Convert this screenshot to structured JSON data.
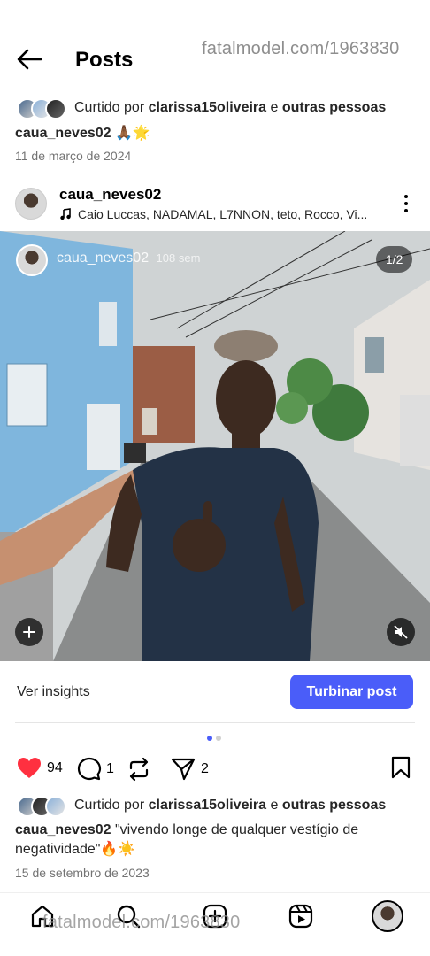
{
  "watermark": "fatalmodel.com/1963830",
  "header": {
    "title": "Posts"
  },
  "top_summary": {
    "liked_prefix": "Curtido por",
    "liked_user": "clarissa15oliveira",
    "liked_connector": "e",
    "liked_suffix": "outras pessoas",
    "caption_user": "caua_neves02",
    "caption_text": "🙏🏾🌟",
    "date": "11 de março de 2024"
  },
  "post": {
    "username": "caua_neves02",
    "audio": "Caio Luccas, NADAMAL, L7NNON, teto, Rocco, Vi...",
    "overlay_username": "caua_neves02",
    "overlay_time": "108 sem",
    "page_indicator": "1/2",
    "insights_label": "Ver insights",
    "boost_label": "Turbinar post",
    "likes_count": "94",
    "comments_count": "1",
    "shares_count": "2",
    "liked_prefix": "Curtido por",
    "liked_user": "clarissa15oliveira",
    "liked_connector": "e",
    "liked_suffix": "outras pessoas",
    "caption_user": "caua_neves02",
    "caption_text": "\"vivendo longe de qualquer vestígio de negatividade\"🔥☀️",
    "date": "15 de setembro de 2023"
  },
  "colors": {
    "accent": "#4a5df9",
    "heart": "#ff3040"
  },
  "icons": [
    "back-arrow-icon",
    "music-note-icon",
    "more-icon",
    "add-icon",
    "mute-icon",
    "heart-icon",
    "comment-icon",
    "repost-icon",
    "send-icon",
    "bookmark-icon",
    "home-icon",
    "search-icon",
    "create-icon",
    "reels-icon"
  ]
}
